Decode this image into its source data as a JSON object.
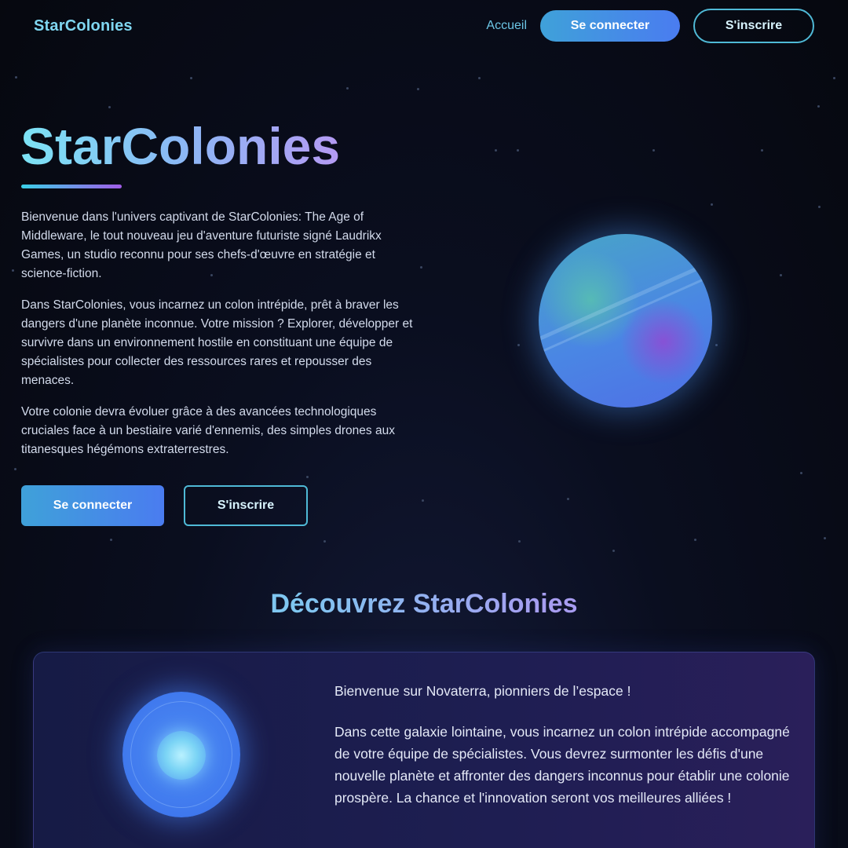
{
  "nav": {
    "brand": "StarColonies",
    "home_label": "Accueil",
    "login_label": "Se connecter",
    "signup_label": "S'inscrire"
  },
  "hero": {
    "title": "StarColonies",
    "paragraphs": [
      "Bienvenue dans l'univers captivant de StarColonies: The Age of Middleware, le tout nouveau jeu d'aventure futuriste signé Laudrikx Games, un studio reconnu pour ses chefs-d'œuvre en stratégie et science-fiction.",
      "Dans StarColonies, vous incarnez un colon intrépide, prêt à braver les dangers d'une planète inconnue. Votre mission ? Explorer, développer et survivre dans un environnement hostile en constituant une équipe de spécialistes pour collecter des ressources rares et repousser des menaces.",
      "Votre colonie devra évoluer grâce à des avancées technologiques cruciales face à un bestiaire varié d'ennemis, des simples drones aux titanesques hégémons extraterrestres."
    ],
    "login_label": "Se connecter",
    "signup_label": "S'inscrire"
  },
  "discover": {
    "title": "Découvrez StarColonies",
    "paragraphs": [
      "Bienvenue sur Novaterra, pionniers de l’espace !",
      "Dans cette galaxie lointaine, vous incarnez un colon intrépide accompagné de votre équipe de spécialistes. Vous devrez surmonter les défis d'une nouvelle planète et affronter des dangers inconnus pour établir une colonie prospère. La chance et l'innovation seront vos meilleures alliées !"
    ]
  },
  "colors": {
    "background": "#070a16",
    "accent_cyan": "#7fd6f0",
    "accent_blue": "#4a7cf0",
    "accent_purple": "#b49af3",
    "outline": "#4fb9d6"
  },
  "icons": [
    "planet-illustration",
    "orb-illustration"
  ]
}
